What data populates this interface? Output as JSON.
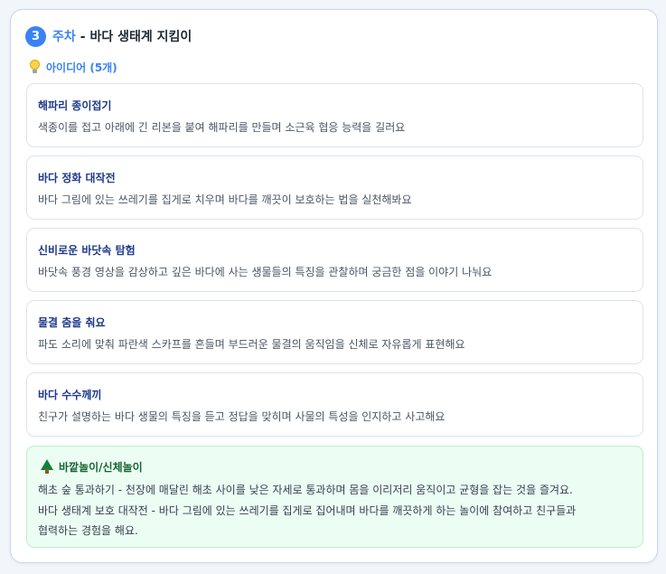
{
  "header": {
    "week_number": "3",
    "week_label": "주차",
    "title": "- 바다 생태계 지킴이"
  },
  "ideas_section": {
    "heading": "아이디어 (5개)",
    "icon": "lightbulb-icon",
    "items": [
      {
        "title": "해파리 종이접기",
        "description": "색종이를 접고 아래에 긴 리본을 붙여 해파리를 만들며 소근육 협응 능력을 길러요"
      },
      {
        "title": "바다 정화 대작전",
        "description": "바다 그림에 있는 쓰레기를 집게로 치우며 바다를 깨끗이 보호하는 법을 실천해봐요"
      },
      {
        "title": "신비로운 바닷속 탐험",
        "description": "바닷속 풍경 영상을 감상하고 깊은 바다에 사는 생물들의 특징을 관찰하며 궁금한 점을 이야기 나눠요"
      },
      {
        "title": "물결 춤을 춰요",
        "description": "파도 소리에 맞춰 파란색 스카프를 흔들며 부드러운 물결의 움직임을 신체로 자유롭게 표현해요"
      },
      {
        "title": "바다 수수께끼",
        "description": "친구가 설명하는 바다 생물의 특징을 듣고 정답을 맞히며 사물의 특성을 인지하고 사고해요"
      }
    ]
  },
  "outdoor_section": {
    "icon": "tree-icon",
    "title": "바깥놀이/신체놀이",
    "lines": [
      "해초 숲 통과하기 - 천장에 매달린 해초 사이를 낮은 자세로 통과하며 몸을 이리저리 움직이고 균형을 잡는 것을 즐겨요.",
      "바다 생태계 보호 대작전 - 바다 그림에 있는 쓰레기를 집게로 집어내며 바다를 깨끗하게 하는 놀이에 참여하고 친구들과",
      "협력하는 경험을 해요."
    ]
  },
  "colors": {
    "accent": "#3b82f6",
    "idea_title": "#1e3a8a",
    "outdoor_bg": "#ecfdf3",
    "outdoor_title": "#166534"
  }
}
